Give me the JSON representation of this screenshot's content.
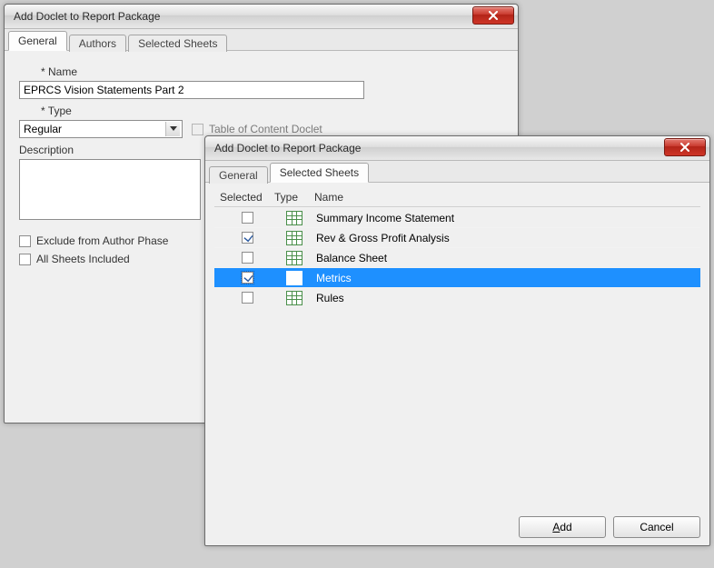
{
  "back": {
    "title": "Add Doclet to Report Package",
    "tabs": [
      "General",
      "Authors",
      "Selected Sheets"
    ],
    "active_tab": "General",
    "name_label": "* Name",
    "name_value": "EPRCS Vision Statements Part 2",
    "type_label": "* Type",
    "type_value": "Regular",
    "toc_label": "Table of Content Doclet",
    "desc_label": "Description",
    "exclude_label": "Exclude from Author Phase",
    "all_sheets_label": "All Sheets Included"
  },
  "front": {
    "title": "Add Doclet to Report Package",
    "tabs": [
      "General",
      "Selected Sheets"
    ],
    "active_tab": "Selected Sheets",
    "headers": {
      "selected": "Selected",
      "type": "Type",
      "name": "Name"
    },
    "rows": [
      {
        "checked": false,
        "name": "Summary Income Statement",
        "highlight": false
      },
      {
        "checked": true,
        "name": "Rev & Gross Profit Analysis",
        "highlight": false
      },
      {
        "checked": false,
        "name": "Balance Sheet",
        "highlight": false
      },
      {
        "checked": true,
        "name": "Metrics",
        "highlight": true
      },
      {
        "checked": false,
        "name": "Rules",
        "highlight": false
      }
    ],
    "add_label": "Add",
    "cancel_label": "Cancel"
  }
}
